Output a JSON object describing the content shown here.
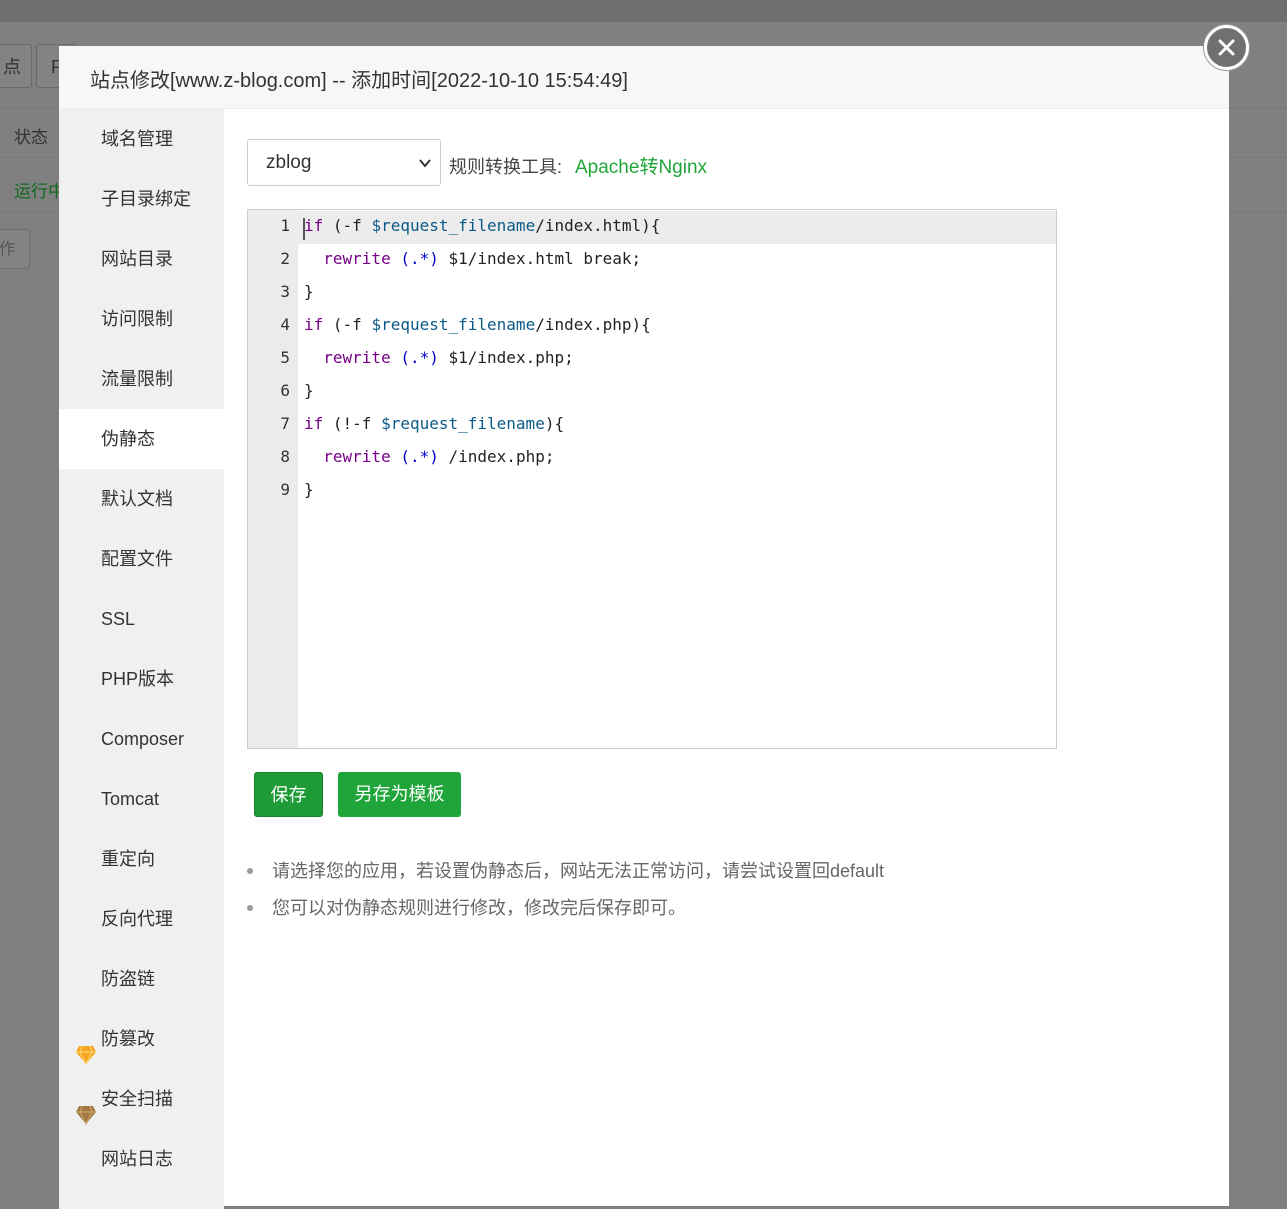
{
  "background": {
    "toolbar_left_text": "点",
    "toolbar_second_text": "P",
    "status_header": "状态",
    "status_value": "运行中",
    "op_button": "作"
  },
  "modal": {
    "title": "站点修改[www.z-blog.com] -- 添加时间[2022-10-10 15:54:49]",
    "close_icon": "close-icon"
  },
  "sidebar": {
    "items": [
      {
        "label": "域名管理"
      },
      {
        "label": "子目录绑定"
      },
      {
        "label": "网站目录"
      },
      {
        "label": "访问限制"
      },
      {
        "label": "流量限制"
      },
      {
        "label": "伪静态",
        "active": true
      },
      {
        "label": "默认文档"
      },
      {
        "label": "配置文件"
      },
      {
        "label": "SSL"
      },
      {
        "label": "PHP版本"
      },
      {
        "label": "Composer"
      },
      {
        "label": "Tomcat"
      },
      {
        "label": "重定向"
      },
      {
        "label": "反向代理"
      },
      {
        "label": "防盗链"
      },
      {
        "label": "防篡改",
        "icon": "gem-gold-icon"
      },
      {
        "label": "安全扫描",
        "icon": "gem-brown-icon"
      },
      {
        "label": "网站日志"
      }
    ]
  },
  "rewrite": {
    "selected_template": "zblog",
    "tool_label": "规则转换工具:",
    "tool_link": "Apache转Nginx",
    "line_numbers": [
      "1",
      "2",
      "3",
      "4",
      "5",
      "6",
      "7",
      "8",
      "9"
    ],
    "code_lines": [
      "if (-f $request_filename/index.html){",
      "  rewrite (.*) $1/index.html break;",
      "}",
      "if (-f $request_filename/index.php){",
      "  rewrite (.*) $1/index.php;",
      "}",
      "if (!-f $request_filename){",
      "  rewrite (.*) /index.php;",
      "}"
    ],
    "save_button": "保存",
    "save_template_button": "另存为模板",
    "tips": [
      "请选择您的应用，若设置伪静态后，网站无法正常访问，请尝试设置回default",
      "您可以对伪静态规则进行修改，修改完后保存即可。"
    ]
  },
  "colors": {
    "accent": "#20a53a",
    "keyword": "#770088",
    "variable": "#0b5a87"
  }
}
